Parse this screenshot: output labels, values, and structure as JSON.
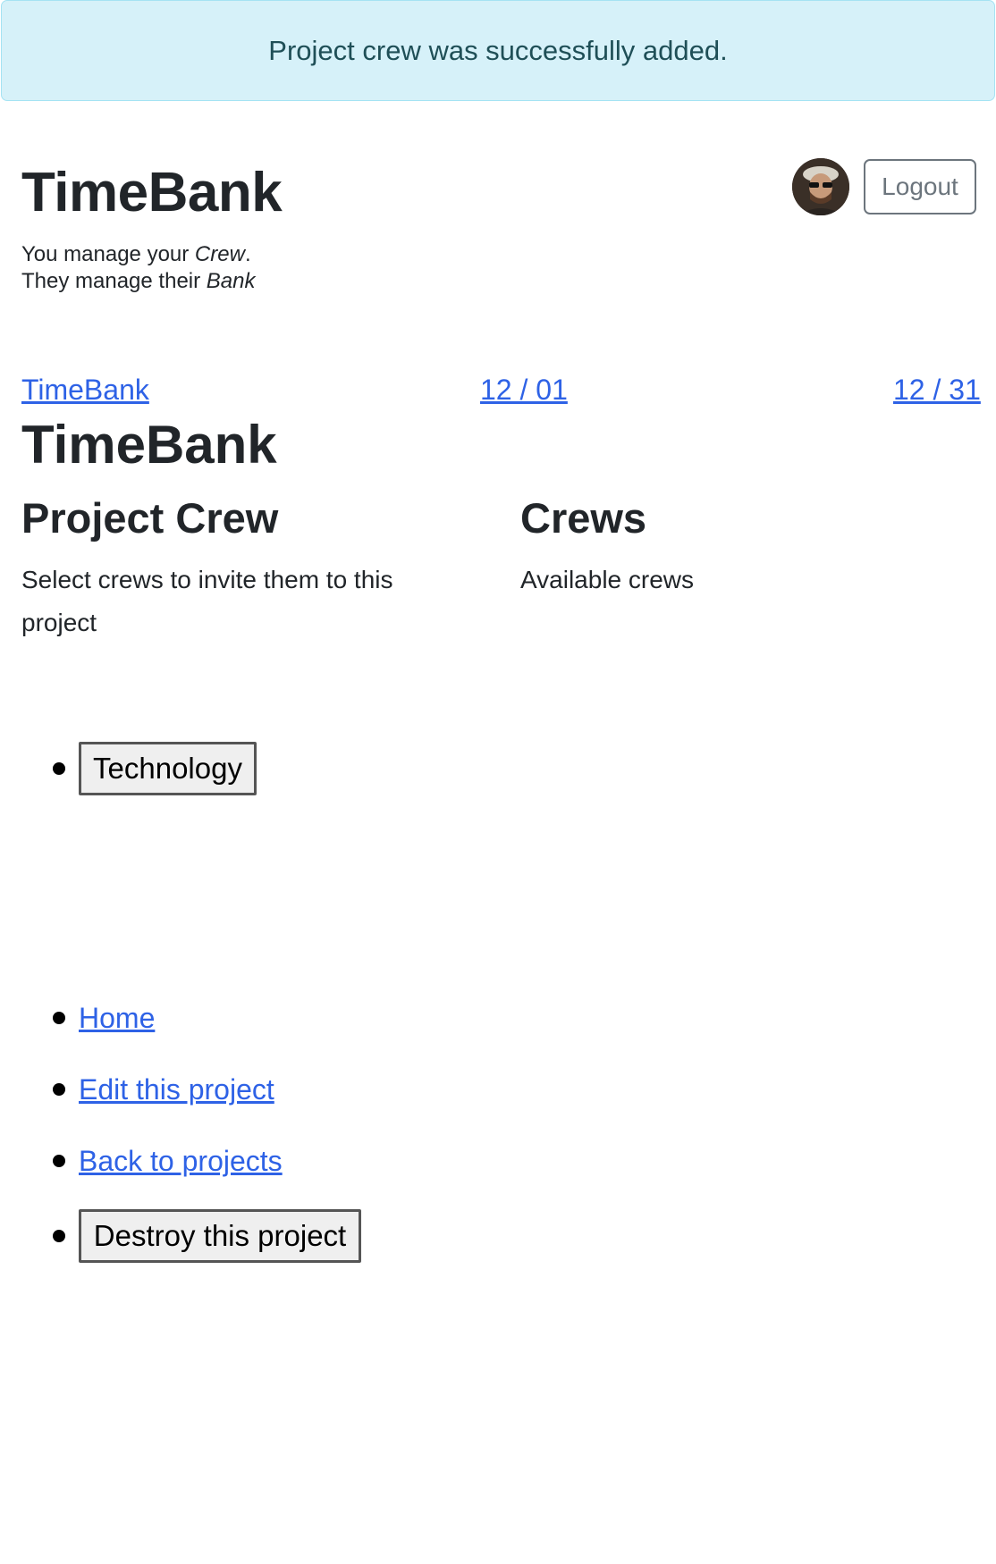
{
  "notice": "Project crew was successfully added.",
  "header": {
    "brand": "TimeBank",
    "tagline_line1_prefix": "You manage your ",
    "tagline_line1_em": "Crew",
    "tagline_line1_suffix": ".",
    "tagline_line2_prefix": "They manage their ",
    "tagline_line2_em": "Bank",
    "logout_label": "Logout"
  },
  "nav": {
    "left": "TimeBank",
    "middle": "12 / 01",
    "right": "12 / 31"
  },
  "project": {
    "title": "TimeBank",
    "left_heading": "Project Crew",
    "left_description": "Select crews to invite them to this project",
    "right_heading": "Crews",
    "right_description": "Available crews"
  },
  "crew_buttons": [
    "Technology"
  ],
  "actions": {
    "home": "Home",
    "edit": "Edit this project",
    "back": "Back to projects",
    "destroy": "Destroy this project"
  }
}
